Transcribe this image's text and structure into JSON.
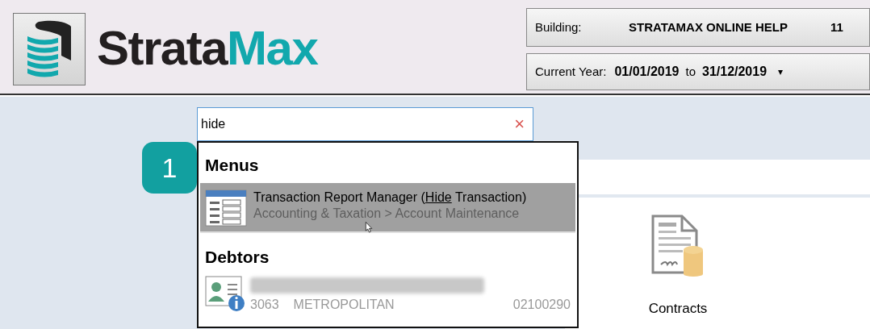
{
  "header": {
    "logo": {
      "part_1": "Strata",
      "part_2": "Max"
    },
    "building": {
      "label": "Building:",
      "value": "STRATAMAX ONLINE HELP",
      "code": "11"
    },
    "year": {
      "label": "Current Year:",
      "from": "01/01/2019",
      "joiner": "to",
      "to": "31/12/2019",
      "caret": "▾"
    }
  },
  "search": {
    "value": "hide",
    "clear": "×"
  },
  "step_badge": "1",
  "results": [
    {
      "heading": "Menus",
      "items": [
        {
          "kind": "menu",
          "selected": true,
          "title_parts": [
            {
              "text": "Transaction Report Manager (",
              "match": false
            },
            {
              "text": "Hide",
              "match": true
            },
            {
              "text": " Transaction)",
              "match": false
            }
          ],
          "path": "Accounting & Taxation > Account Maintenance"
        }
      ]
    },
    {
      "heading": "Debtors",
      "items": [
        {
          "kind": "debtor",
          "selected": false,
          "redacted": true,
          "lot": "3063",
          "suburb": "METROPOLITAN",
          "account": "02100290"
        }
      ]
    }
  ],
  "tiles": [
    {
      "label": "Contracts"
    }
  ]
}
